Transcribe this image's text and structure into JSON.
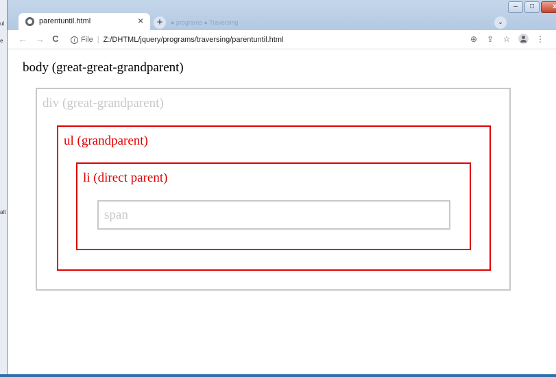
{
  "desktop": {
    "labels": [
      "ul",
      "e",
      "alt"
    ]
  },
  "browser": {
    "tab_title": "parentuntil.html",
    "tab_close": "×",
    "new_tab": "+",
    "background_tabs": "● programs ● Traversing",
    "tab_search": "⌄",
    "window_controls": {
      "minimize": "–",
      "maximize": "□",
      "close": "x"
    }
  },
  "toolbar": {
    "back": "←",
    "forward": "→",
    "reload": "C",
    "info": "i",
    "file_label": "File",
    "separator": "|",
    "url": "Z:/DHTML/jquery/programs/traversing/parentuntil.html",
    "icons": [
      "zoom-icon",
      "share-icon",
      "bookmark-star-icon",
      "profile-icon",
      "menu-icon"
    ],
    "zoom": "⊕",
    "share": "⇪",
    "star": "☆",
    "menu": "⋮"
  },
  "page": {
    "body_label": "body (great-great-grandparent)",
    "div_label": "div (great-grandparent)",
    "ul_label": "ul (grandparent)",
    "li_label": "li (direct parent)",
    "span_label": "span"
  },
  "colors": {
    "highlight": "#e00000",
    "muted": "#c8c8c8"
  }
}
